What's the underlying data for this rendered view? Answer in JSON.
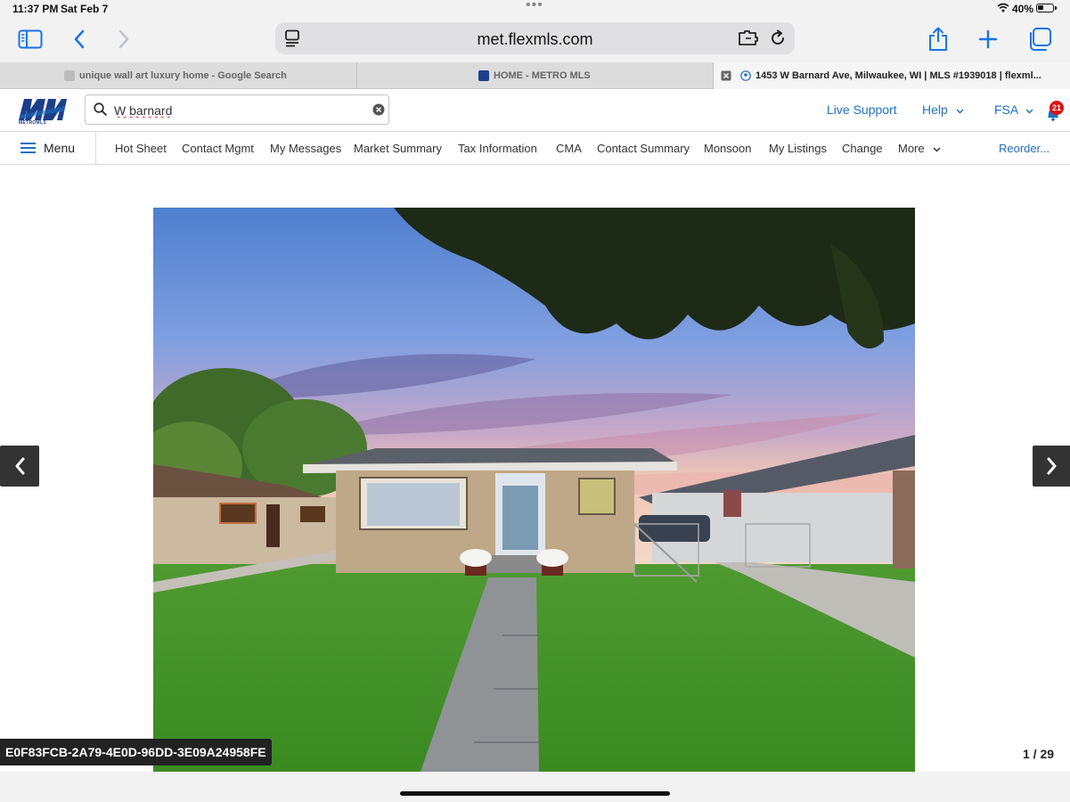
{
  "status_bar": {
    "time": "11:37 PM",
    "date": "Sat Feb 7",
    "battery": "40%",
    "battery_level": 0.4,
    "dots": "•••"
  },
  "browser": {
    "url": "met.flexmls.com",
    "icons": [
      "sidebar-icon",
      "back-icon",
      "forward-icon",
      "reader-icon",
      "extension-icon",
      "reload-icon",
      "share-icon",
      "new-tab-icon",
      "tabs-overview-icon"
    ]
  },
  "tabs": [
    {
      "title": "unique wall art luxury home - Google Search",
      "favicon": "google-favicon",
      "active": false
    },
    {
      "title": "HOME - METRO MLS",
      "favicon": "metromls-favicon",
      "active": false
    },
    {
      "title": "1453 W Barnard Ave, Milwaukee, WI | MLS #1939018 | flexml...",
      "favicon": "location-favicon",
      "active": true
    }
  ],
  "header": {
    "logo_text": "METROMLS",
    "search_value": "W barnard",
    "links": {
      "live_support": "Live Support",
      "help": "Help",
      "fsa": "FSA"
    },
    "notification_count": "21"
  },
  "nav": {
    "menu_label": "Menu",
    "items": [
      "Hot Sheet",
      "Contact Mgmt",
      "My Messages",
      "Market Summary",
      "Tax Information",
      "CMA",
      "Contact Summary",
      "Monsoon",
      "My Listings",
      "Change",
      "More"
    ],
    "reorder_label": "Reorder..."
  },
  "gallery": {
    "image_code": "E0F83FCB-2A79-4E0D-96DD-3E09A24958FE",
    "counter": "1 / 29"
  },
  "colors": {
    "accent": "#1f6fbf",
    "safari_blue": "#1a73e8",
    "logo_blue": "#1b3f8a",
    "badge_red": "#dd1111"
  }
}
